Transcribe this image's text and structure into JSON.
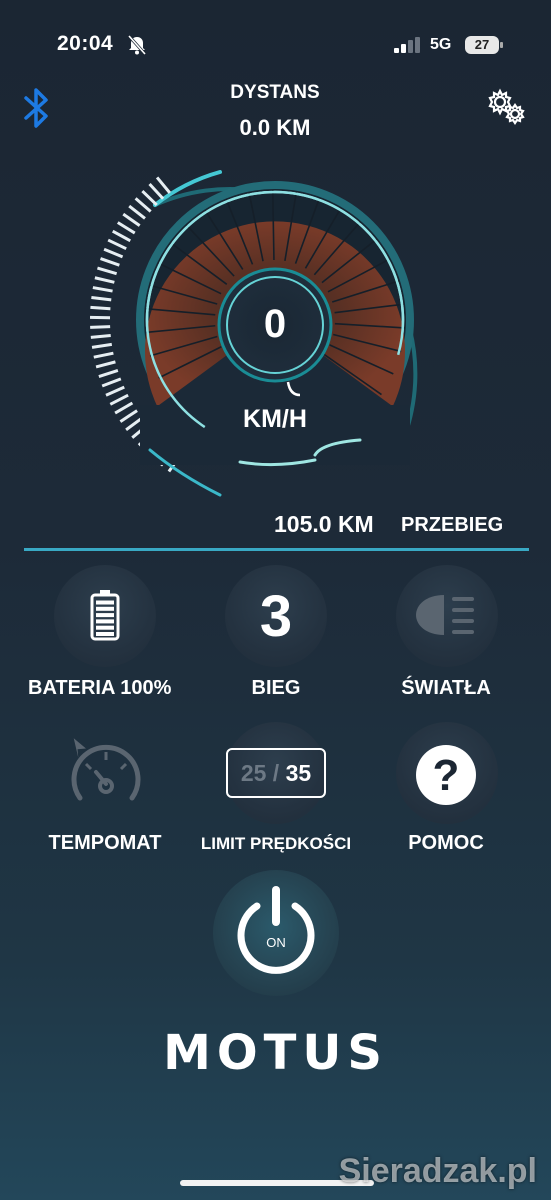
{
  "status_bar": {
    "time": "20:04",
    "network": "5G",
    "battery": "27"
  },
  "header": {
    "distance_label": "DYSTANS",
    "distance_value": "0.0 KM"
  },
  "gauge": {
    "speed": "0",
    "unit": "KM/H"
  },
  "odometer": {
    "value": "105.0 KM",
    "label": "PRZEBIEG"
  },
  "tiles": {
    "battery_label": "BATERIA  100%",
    "battery_level": 1.0,
    "gear_value": "3",
    "gear_label": "BIEG",
    "lights_label": "ŚWIATŁA",
    "cruise_label": "TEMPOMAT",
    "limit_low": "25",
    "limit_sep": "/",
    "limit_high": "35",
    "limit_label": "LIMIT PRĘDKOŚCI",
    "help_label": "POMOC"
  },
  "power": {
    "label": "ON"
  },
  "brand": "MOTUS",
  "watermark": "Sieradzak.pl",
  "colors": {
    "accent": "#3bb8c9",
    "bluetooth": "#1d7ae3",
    "gauge_fill": "#6b3526"
  },
  "icons": [
    "bluetooth-icon",
    "gear-settings-icon",
    "battery-icon",
    "headlight-icon",
    "cruise-control-icon",
    "question-icon",
    "power-icon",
    "bell-slash-icon",
    "signal-icon"
  ]
}
